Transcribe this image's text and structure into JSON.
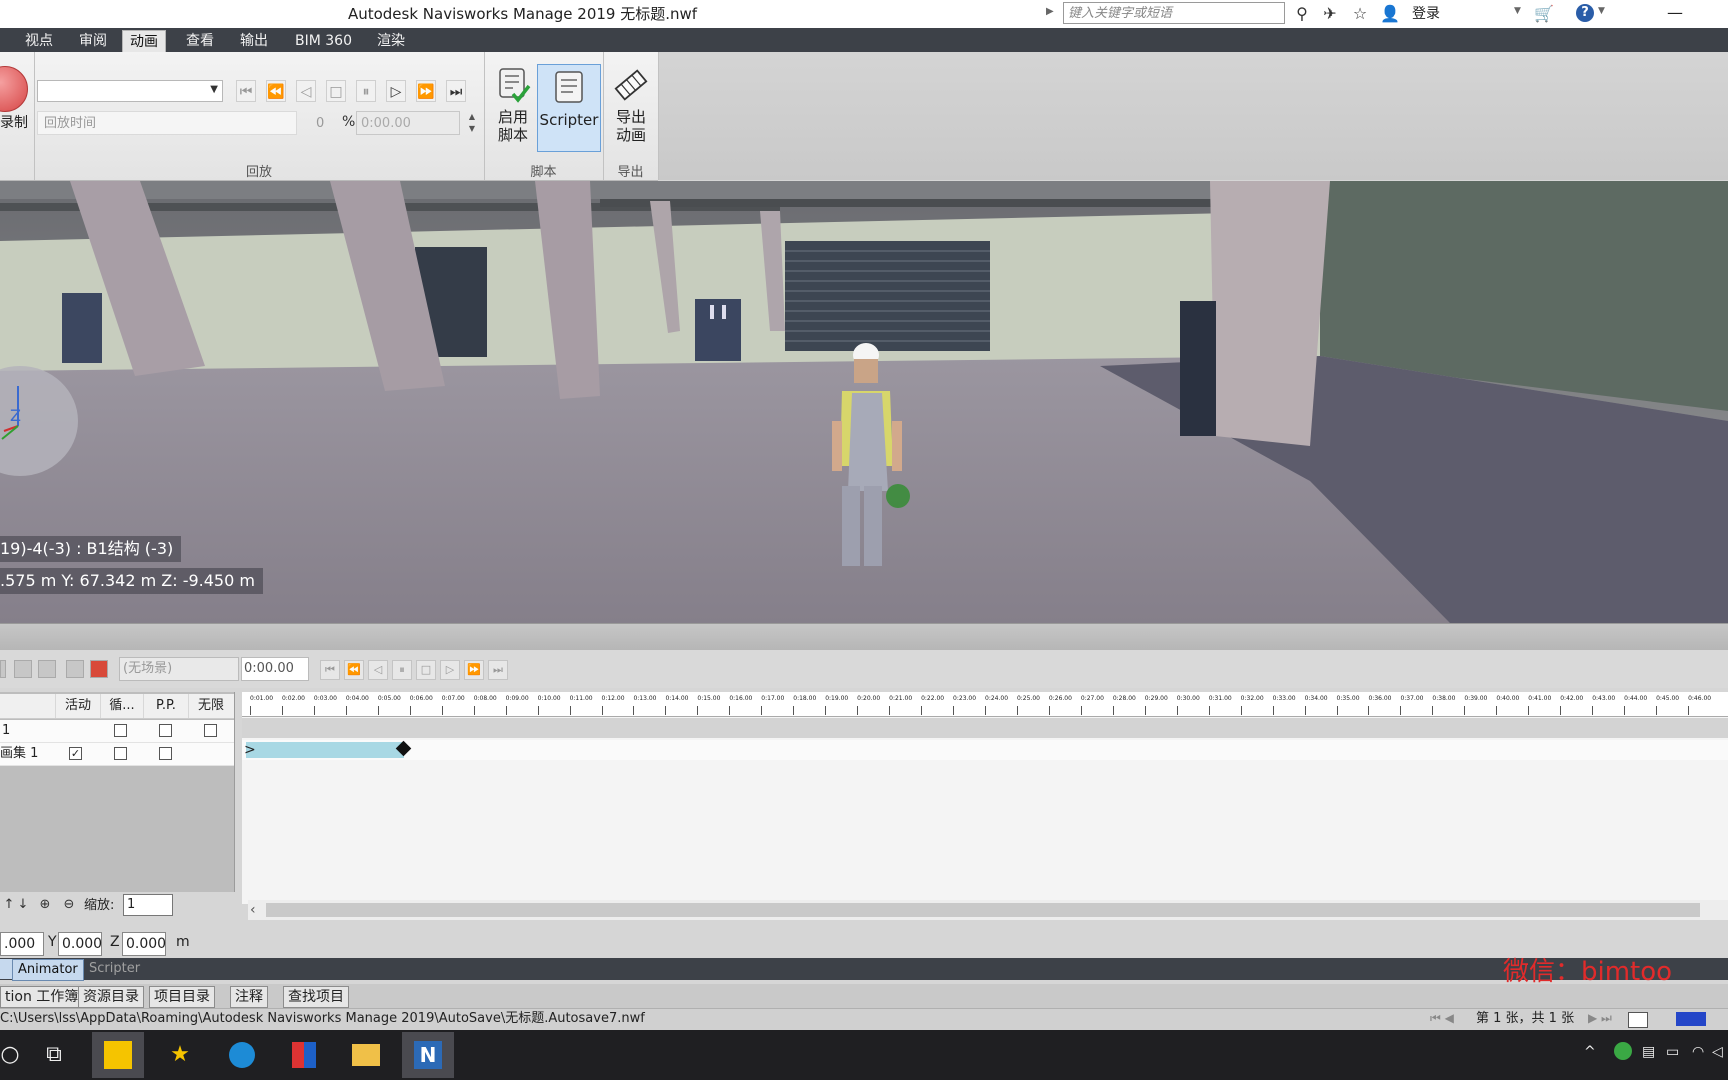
{
  "titlebar": {
    "title": "Autodesk Navisworks Manage 2019    无标题.nwf",
    "search_placeholder": "键入关键字或短语",
    "login_label": "登录",
    "help_label": "?",
    "minimize_label": "—"
  },
  "menu": {
    "tabs": [
      "视点",
      "审阅",
      "动画",
      "查看",
      "输出",
      "BIM 360",
      "渲染"
    ],
    "active": "动画"
  },
  "ribbon": {
    "record_label": "录制",
    "playback_time_label": "回放时间",
    "playback_position": "0",
    "percent_symbol": "%",
    "playback_time_value": "0:00.00",
    "playback_group": "回放",
    "enable_script_label_1": "启用",
    "enable_script_label_2": "脚本",
    "scripter_label": "Scripter",
    "script_group": "脚本",
    "export_label_1": "导出",
    "export_label_2": "动画",
    "export_group": "导出"
  },
  "viewport": {
    "axis_label": "Z",
    "element_label": "19)-4(-3) : B1结构 (-3)",
    "coords_label": ".575 m  Y: 67.342 m  Z: -9.450 m"
  },
  "animator": {
    "scene_select": "(无场景)",
    "scene_time": "0:00.00",
    "columns": [
      "活动",
      "循...",
      "P.P.",
      "无限"
    ],
    "rows": [
      {
        "name": "1",
        "active": false,
        "loop": false,
        "pp": false,
        "infinite": false
      },
      {
        "name": "画集 1",
        "active": true,
        "loop": false,
        "pp": false
      }
    ],
    "zoom_label": "缩放:",
    "zoom_value": "1",
    "ruler_ticks": [
      "0:01.00",
      "0:02.00",
      "0:03.00",
      "0:04.00",
      "0:05.00",
      "0:06.00",
      "0:07.00",
      "0:08.00",
      "0:09.00",
      "0:10.00",
      "0:11.00",
      "0:12.00",
      "0:13.00",
      "0:14.00",
      "0:15.00",
      "0:16.00",
      "0:17.00",
      "0:18.00",
      "0:19.00",
      "0:20.00",
      "0:21.00",
      "0:22.00",
      "0:23.00",
      "0:24.00",
      "0:25.00",
      "0:26.00",
      "0:27.00",
      "0:28.00",
      "0:29.00",
      "0:30.00",
      "0:31.00",
      "0:32.00",
      "0:33.00",
      "0:34.00",
      "0:35.00",
      "0:36.00",
      "0:37.00",
      "0:38.00",
      "0:39.00",
      "0:40.00",
      "0:41.00",
      "0:42.00",
      "0:43.00",
      "0:44.00",
      "0:45.00",
      "0:46.00"
    ]
  },
  "coords": {
    "x_value": ".000",
    "y_label": "Y",
    "y_value": "0.000",
    "z_label": "Z",
    "z_value": "0.000",
    "unit": "m"
  },
  "panel_tabs": {
    "animator": "Animator",
    "scripter": "Scripter",
    "watermark": "微信：bimtoo"
  },
  "bottom_tabs": [
    "tion 工作簿",
    "资源目录",
    "项目目录",
    "注释",
    "查找项目"
  ],
  "status": {
    "path": "C:\\Users\\lss\\AppData\\Roaming\\Autodesk Navisworks Manage 2019\\AutoSave\\无标题.Autosave7.nwf",
    "page": "第 1 张，共 1 张"
  },
  "colors": {
    "menubar": "#3d4148",
    "accent_blue": "#6aa0d8",
    "keyframe_bar": "#a8d8e4",
    "watermark": "#e12b2b"
  }
}
